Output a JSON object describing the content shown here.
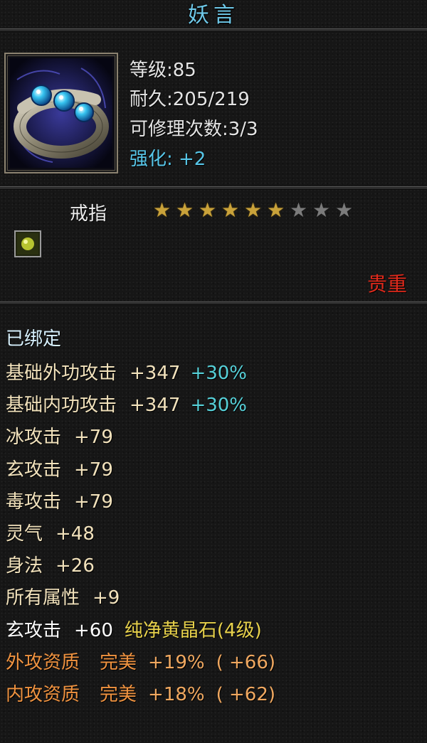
{
  "item": {
    "name": "妖言",
    "level": "等级:85",
    "durability": "耐久:205/219",
    "repair": "可修理次数:3/3",
    "enhance": "强化: +2",
    "type": "戒指",
    "stars": {
      "lit": 6,
      "total": 9
    },
    "rarity": "贵重",
    "bound": "已绑定"
  },
  "attributes": [
    {
      "name": "基础外功攻击",
      "value": "+347",
      "pct": "+30%"
    },
    {
      "name": "基础内功攻击",
      "value": "+347",
      "pct": "+30%"
    },
    {
      "name": "冰攻击",
      "value": "+79"
    },
    {
      "name": "玄攻击",
      "value": "+79"
    },
    {
      "name": "毒攻击",
      "value": "+79"
    },
    {
      "name": "灵气",
      "value": "+48"
    },
    {
      "name": "身法",
      "value": "+26"
    },
    {
      "name": "所有属性",
      "value": "+9"
    }
  ],
  "gem_line": {
    "name": "玄攻击",
    "value": "+60",
    "gem": "纯净黄晶石(4级)"
  },
  "quality": [
    {
      "name": "外攻资质",
      "grade": "完美",
      "pct": "+19%",
      "extra": "( +66)"
    },
    {
      "name": "内攻资质",
      "grade": "完美",
      "pct": "+18%",
      "extra": "( +62)"
    }
  ],
  "icons": {
    "item": "blue-gem-ring-icon",
    "socket": "yellow-gem-icon",
    "star": "star-icon"
  },
  "colors": {
    "title": "#6ec8e8",
    "rarity": "#e02a1c",
    "enhance": "#57c6e8",
    "percent": "#56d0d8",
    "gem": "#e8d24c",
    "quality": "#f09340"
  }
}
